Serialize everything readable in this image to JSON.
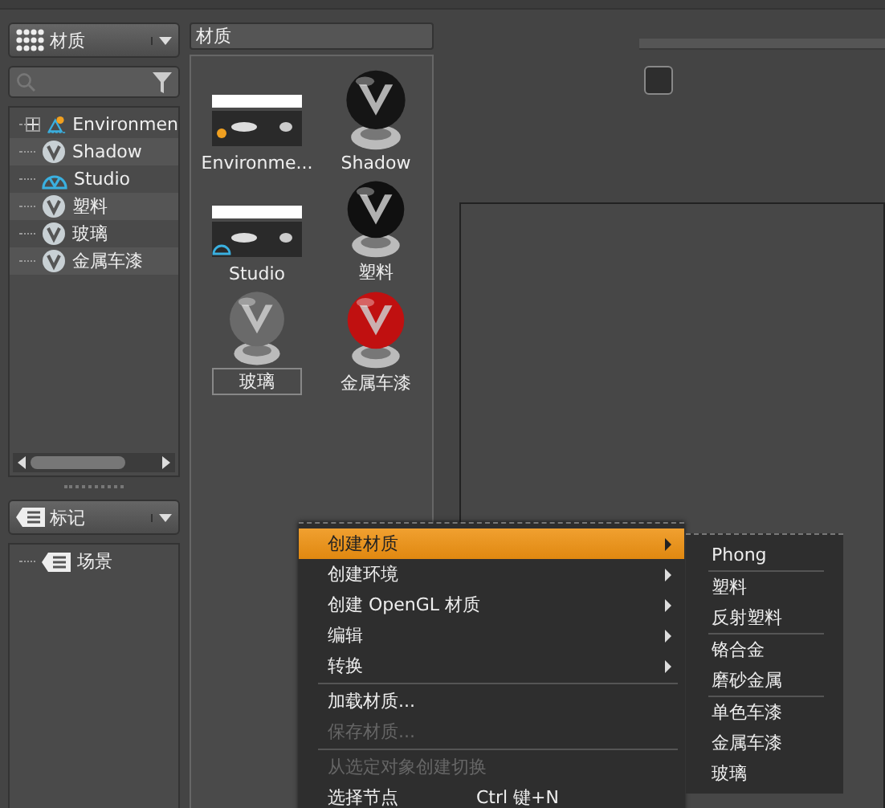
{
  "library": {
    "label": "材质"
  },
  "tree": [
    {
      "label": "Environmen",
      "kind": "environment",
      "expanded": false
    },
    {
      "label": "Shadow",
      "kind": "material"
    },
    {
      "label": "Studio",
      "kind": "studio"
    },
    {
      "label": "塑料",
      "kind": "material"
    },
    {
      "label": "玻璃",
      "kind": "material"
    },
    {
      "label": "金属车漆",
      "kind": "material"
    }
  ],
  "tags": {
    "label": "标记",
    "items": [
      {
        "label": "场景"
      }
    ]
  },
  "panel": {
    "title": "材质",
    "items": [
      {
        "label": "Environme...",
        "kind": "environment",
        "selected": false
      },
      {
        "label": "Shadow",
        "kind": "sphere",
        "color": "#151515",
        "selected": false
      },
      {
        "label": "Studio",
        "kind": "studio",
        "selected": false
      },
      {
        "label": "塑料",
        "kind": "sphere",
        "color": "#101010",
        "selected": false
      },
      {
        "label": "玻璃",
        "kind": "sphere",
        "color": "#6a6a6a",
        "selected": true
      },
      {
        "label": "金属车漆",
        "kind": "sphere",
        "color": "#c01010",
        "selected": false
      }
    ]
  },
  "context_menu": [
    {
      "kind": "item",
      "label": "创建材质",
      "submenu": true,
      "selected": true,
      "disabled": false
    },
    {
      "kind": "item",
      "label": "创建环境",
      "submenu": true,
      "selected": false,
      "disabled": false
    },
    {
      "kind": "item",
      "label": "创建 OpenGL 材质",
      "submenu": true,
      "selected": false,
      "disabled": false
    },
    {
      "kind": "item",
      "label": "编辑",
      "submenu": true,
      "selected": false,
      "disabled": false
    },
    {
      "kind": "item",
      "label": "转换",
      "submenu": true,
      "selected": false,
      "disabled": false
    },
    {
      "kind": "separator"
    },
    {
      "kind": "item",
      "label": "加载材质...",
      "submenu": false,
      "selected": false,
      "disabled": false
    },
    {
      "kind": "item",
      "label": "保存材质...",
      "submenu": false,
      "selected": false,
      "disabled": true
    },
    {
      "kind": "separator"
    },
    {
      "kind": "item",
      "label": "从选定对象创建切换",
      "submenu": false,
      "selected": false,
      "disabled": true
    },
    {
      "kind": "item",
      "label": "选择节点",
      "shortcut": "Ctrl 键+N",
      "submenu": false,
      "selected": false,
      "disabled": false
    }
  ],
  "submenu": [
    {
      "kind": "item",
      "label": "Phong"
    },
    {
      "kind": "separator"
    },
    {
      "kind": "item",
      "label": "塑料"
    },
    {
      "kind": "item",
      "label": "反射塑料"
    },
    {
      "kind": "separator"
    },
    {
      "kind": "item",
      "label": "铬合金"
    },
    {
      "kind": "item",
      "label": "磨砂金属"
    },
    {
      "kind": "separator"
    },
    {
      "kind": "item",
      "label": "单色车漆"
    },
    {
      "kind": "item",
      "label": "金属车漆"
    },
    {
      "kind": "item",
      "label": "玻璃"
    }
  ]
}
